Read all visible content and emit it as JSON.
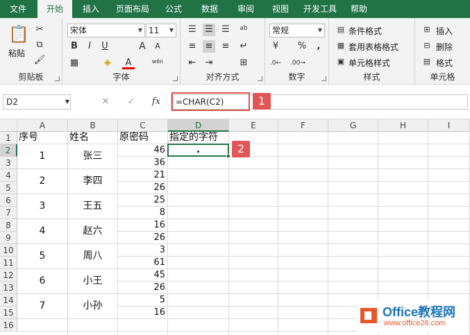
{
  "ribbon_tabs": [
    "文件",
    "开始",
    "插入",
    "页面布局",
    "公式",
    "数据",
    "审阅",
    "视图",
    "开发工具",
    "帮助"
  ],
  "active_tab": "开始",
  "clipboard": {
    "paste_label": "粘贴",
    "group_label": "剪贴板"
  },
  "font": {
    "name": "宋体",
    "size": "11",
    "bold": "B",
    "italic": "I",
    "underline": "U",
    "grow": "A",
    "shrink": "A",
    "font_color_glyph": "A",
    "wen": "wén",
    "group_label": "字体"
  },
  "alignment": {
    "group_label": "对齐方式",
    "orient": "ab"
  },
  "number": {
    "format": "常规",
    "percent": "%",
    "comma": ",",
    "group_label": "数字"
  },
  "styles": {
    "conditional": "条件格式",
    "table": "套用表格格式",
    "cell": "单元格样式",
    "group_label": "样式"
  },
  "cells": {
    "insert": "插入",
    "delete": "删除",
    "format": "格式",
    "group_label": "单元格"
  },
  "formula_bar": {
    "name_box": "D2",
    "fx": "fx",
    "formula": "=CHAR(C2)",
    "cancel": "✕",
    "confirm": "✓"
  },
  "callouts": {
    "one": "1",
    "two": "2"
  },
  "columns": [
    "A",
    "B",
    "C",
    "D",
    "E",
    "F",
    "G",
    "H",
    "I"
  ],
  "rows": [
    "1",
    "2",
    "3",
    "4",
    "5",
    "6",
    "7",
    "8",
    "9",
    "10",
    "11",
    "12",
    "13",
    "14",
    "15",
    "16"
  ],
  "headers": {
    "a": "序号",
    "b": "姓名",
    "c": "原密码",
    "d": "指定的字符"
  },
  "people": [
    {
      "no": "1",
      "name": "张三",
      "codes": [
        "46",
        "36"
      ]
    },
    {
      "no": "2",
      "name": "李四",
      "codes": [
        "21",
        "26"
      ]
    },
    {
      "no": "3",
      "name": "王五",
      "codes": [
        "25",
        "8"
      ]
    },
    {
      "no": "4",
      "name": "赵六",
      "codes": [
        "16",
        "26"
      ]
    },
    {
      "no": "5",
      "name": "周八",
      "codes": [
        "3",
        "61"
      ]
    },
    {
      "no": "6",
      "name": "小王",
      "codes": [
        "45",
        "26"
      ]
    },
    {
      "no": "7",
      "name": "小孙",
      "codes": [
        "5",
        "16"
      ]
    }
  ],
  "d2_value": ".",
  "watermark": {
    "brand": "Office教程网",
    "url": "www.office26.com"
  },
  "colors": {
    "excel_green": "#217346",
    "callout_red": "#e05656",
    "watermark_orange": "#e8572a",
    "watermark_blue": "#1a73b8"
  }
}
